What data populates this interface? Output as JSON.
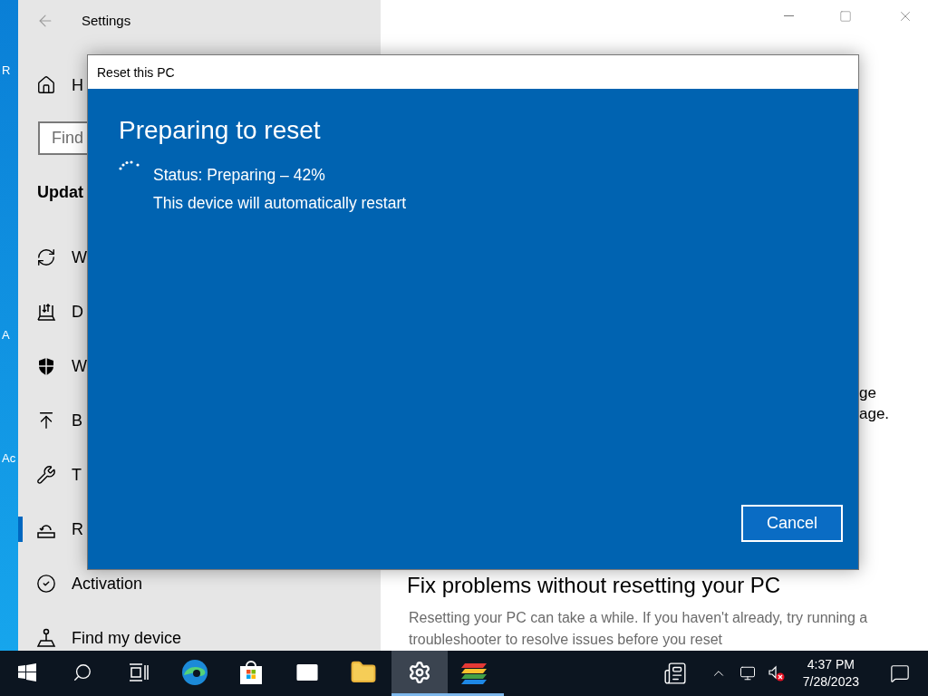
{
  "desktop": {
    "icon_labels": [
      "R",
      "A",
      "Ac"
    ]
  },
  "settings_window": {
    "title": "Settings",
    "sidebar": {
      "home": "H",
      "search_placeholder": "Find",
      "section": "Updat",
      "items": [
        {
          "kind": "sync",
          "label": "W",
          "selected": false
        },
        {
          "kind": "delivery",
          "label": "D",
          "selected": false
        },
        {
          "kind": "shield",
          "label": "W",
          "selected": false
        },
        {
          "kind": "backup",
          "label": "B",
          "selected": false
        },
        {
          "kind": "wrench",
          "label": "T",
          "selected": false
        },
        {
          "kind": "recovery",
          "label": "R",
          "selected": true
        },
        {
          "kind": "activation",
          "label": "Activation",
          "selected": false
        },
        {
          "kind": "find",
          "label": "Find my device",
          "selected": false
        }
      ]
    },
    "content": {
      "fragments": [
        "ge",
        "age."
      ],
      "heading": "Fix problems without resetting your PC",
      "paragraph": "Resetting your PC can take a while. If you haven't already, try running a troubleshooter to resolve issues before you reset"
    }
  },
  "dialog": {
    "title": "Reset this PC",
    "heading": "Preparing to reset",
    "status": "Status: Preparing – 42%",
    "note": "This device will automatically restart",
    "button": "Cancel"
  },
  "taskbar": {
    "apps": [
      {
        "kind": "start",
        "selected": false,
        "running": false
      },
      {
        "kind": "search",
        "selected": false,
        "running": false
      },
      {
        "kind": "taskview",
        "selected": false,
        "running": false
      },
      {
        "kind": "edge",
        "selected": false,
        "running": false
      },
      {
        "kind": "store",
        "selected": false,
        "running": false
      },
      {
        "kind": "mail",
        "selected": false,
        "running": false
      },
      {
        "kind": "explorer",
        "selected": false,
        "running": false
      },
      {
        "kind": "settings",
        "selected": true,
        "running": true
      },
      {
        "kind": "stack",
        "selected": false,
        "running": true
      }
    ],
    "time": "4:37 PM",
    "date": "7/28/2023"
  }
}
